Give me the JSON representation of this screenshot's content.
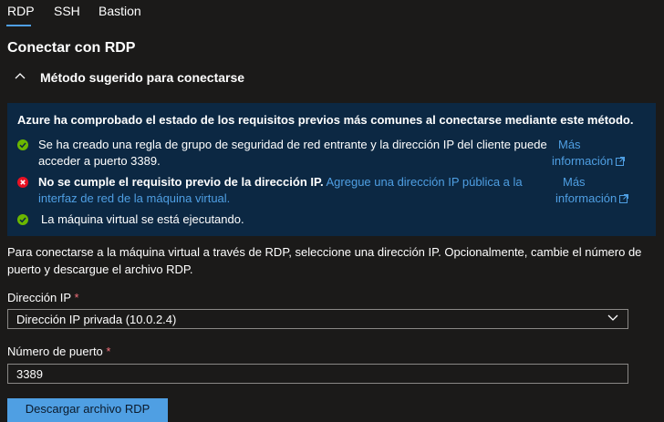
{
  "tabs": [
    {
      "label": "RDP",
      "active": true
    },
    {
      "label": "SSH",
      "active": false
    },
    {
      "label": "Bastion",
      "active": false
    }
  ],
  "section_title": "Conectar con RDP",
  "expander": {
    "label": "Método sugerido para conectarse",
    "expanded": true,
    "icon": "chevron-up-icon"
  },
  "info": {
    "heading": "Azure ha comprobado el estado de los requisitos previos más comunes al conectarse mediante este método.",
    "items": [
      {
        "status": "success",
        "text": "Se ha creado una regla de grupo de seguridad de red entrante y la dirección IP del cliente puede acceder a puerto 3389.",
        "more_line1": "Más",
        "more_line2": "información"
      },
      {
        "status": "error",
        "bold": "No se cumple el requisito previo de la dirección IP.",
        "link": "Agregue una dirección IP pública a la interfaz de red de la máquina virtual.",
        "more_line1": "Más",
        "more_line2": "información"
      },
      {
        "status": "success",
        "text": "La máquina virtual se está ejecutando."
      }
    ]
  },
  "description": "Para conectarse a la máquina virtual a través de RDP, seleccione una dirección IP. Opcionalmente, cambie el número de puerto y descargue el archivo RDP.",
  "ip_field": {
    "label": "Dirección IP",
    "required": "*",
    "value": "Dirección IP privada (10.0.2.4)"
  },
  "port_field": {
    "label": "Número de puerto",
    "required": "*",
    "value": "3389"
  },
  "download_button": "Descargar archivo RDP",
  "colors": {
    "accent": "#4f9fe3",
    "success": "#6bb700",
    "error": "#e81123",
    "info_bg": "#0c2843"
  }
}
